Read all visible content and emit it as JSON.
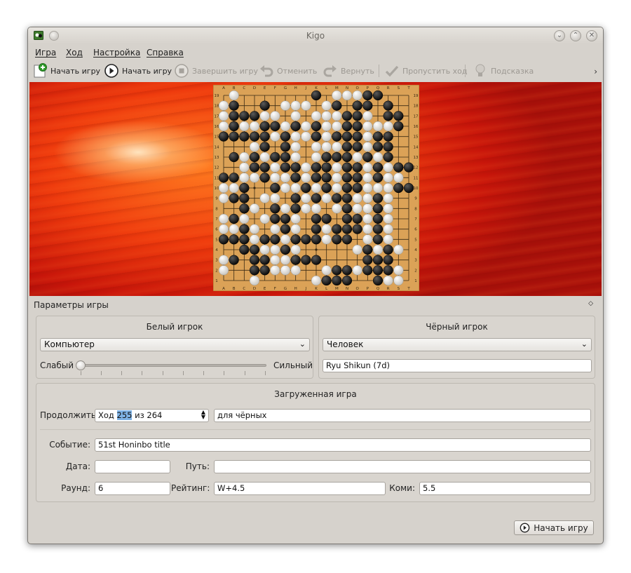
{
  "window": {
    "title": "Kigo"
  },
  "menu": [
    "Игра",
    "Ход",
    "Настройка",
    "Справка"
  ],
  "toolbar": {
    "new_game": "Начать игру",
    "start_game": "Начать игру",
    "finish_game": "Завершить игру",
    "undo": "Отменить",
    "redo": "Вернуть",
    "pass": "Пропустить ход",
    "hint": "Подсказка",
    "more": "›"
  },
  "board": {
    "columns": [
      "A",
      "B",
      "C",
      "D",
      "E",
      "F",
      "G",
      "H",
      "J",
      "K",
      "L",
      "M",
      "N",
      "O",
      "P",
      "Q",
      "R",
      "S",
      "T"
    ],
    "rows": [
      "19",
      "18",
      "17",
      "16",
      "15",
      "14",
      "13",
      "12",
      "11",
      "10",
      "9",
      "8",
      "7",
      "6",
      "5",
      "4",
      "3",
      "2",
      "1"
    ],
    "stones": [
      ".W.......B.WWWBB...",
      "WB..B.WWW.WB.BB.B..",
      "WBBBWW.W.WWWBBW.BB.",
      "WBWWBBWBWBWWBBWWWB.",
      "BBBBBWBWWBWBBBWBB..",
      "...WB.BW.WWWBBWBB..",
      ".BWBWBBW.WBBBWBWB..",
      "..WBBWBBWBBWBBWBWBB",
      "BBWWBWWBWBBWBBWBWW.",
      "WWB..BWWBWBWBBWWWBB",
      "WBB.WW.BWBWBBWWBW..",
      "..BW.BWBWW.WBWWBW..",
      "WBW.WBBW.BB.BBWBW..",
      "WWBW.WBW.BWBBBWBW..",
      "BBBWBBWBBBWBB.WBW..",
      "..BBWWBW.....WBWBW.",
      "WB.BBWWBBB....BBB..",
      "W..BBWWW..WBBWBBBW.",
      "...W.....WBBB..BWW."
    ]
  },
  "params": {
    "header": "Параметры игры",
    "toggle": "◇"
  },
  "white": {
    "title": "Белый игрок",
    "type": "Компьютер",
    "weak": "Слабый",
    "strong": "Сильный",
    "strength": 0.0
  },
  "black": {
    "title": "Чёрный игрок",
    "type": "Человек",
    "name": "Ryu Shikun (7d)"
  },
  "loaded": {
    "title": "Загруженная игра",
    "continue_label": "Продолжить",
    "move_prefix": "Ход",
    "move_current": "255",
    "move_suffix": "из 264",
    "for_side": "для чёрных",
    "event_label": "Событие:",
    "event": "51st Honinbo title",
    "date_label": "Дата:",
    "date": "",
    "path_label": "Путь:",
    "path": "",
    "round_label": "Раунд:",
    "round": "6",
    "rating_label": "Рейтинг:",
    "rating": "W+4.5",
    "komi_label": "Коми:",
    "komi": "5.5"
  },
  "footer": {
    "start": "Начать игру"
  },
  "colors": {
    "board": "#dba257",
    "background_red": "#d8210c",
    "window": "#d6d2cc"
  }
}
